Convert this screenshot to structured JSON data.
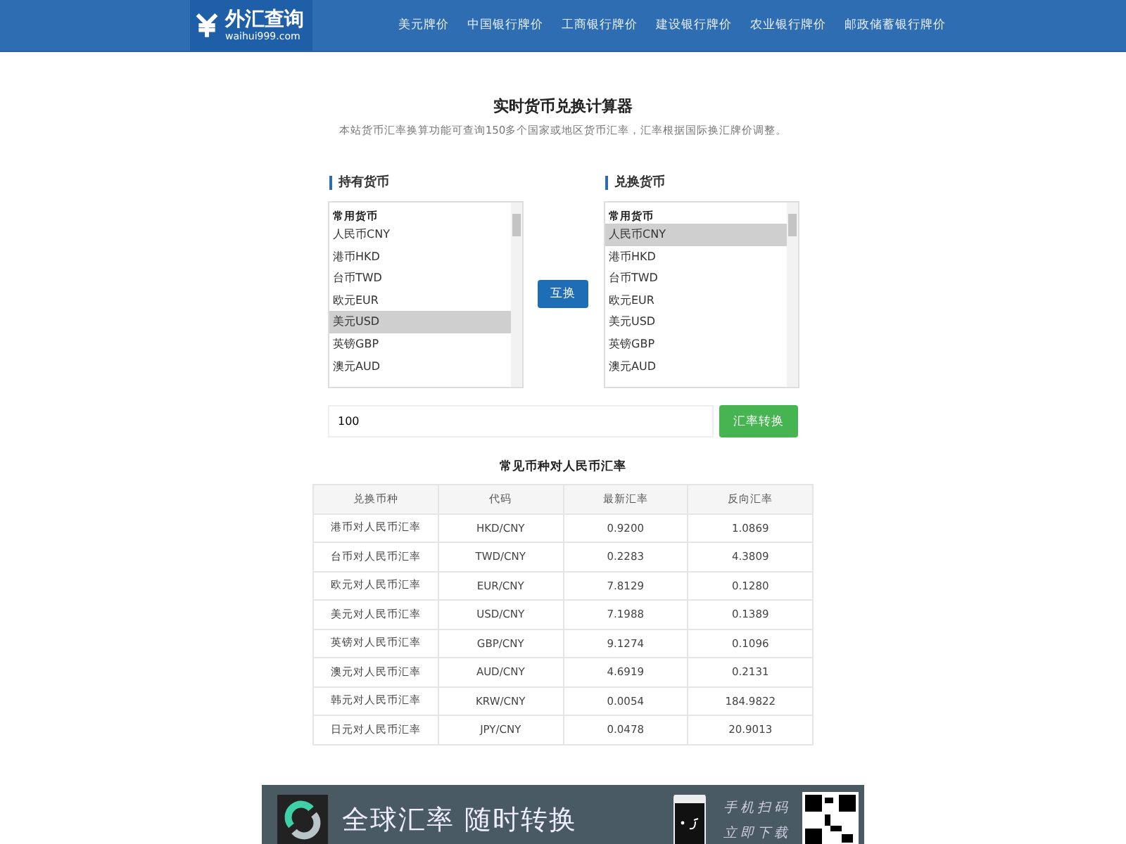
{
  "site": {
    "logo_text": "外汇查询",
    "logo_domain": "waihui999.com"
  },
  "nav": [
    "美元牌价",
    "中国银行牌价",
    "工商银行牌价",
    "建设银行牌价",
    "农业银行牌价",
    "邮政储蓄银行牌价"
  ],
  "title": "实时货币兑换计算器",
  "subtitle": "本站货币汇率换算功能可查询150多个国家或地区货币汇率，汇率根据国际换汇牌价调整。",
  "from": {
    "label": "持有货币",
    "group": "常用货币",
    "items": [
      {
        "label": "人民币CNY",
        "selected": false
      },
      {
        "label": "港币HKD",
        "selected": false
      },
      {
        "label": "台币TWD",
        "selected": false
      },
      {
        "label": "欧元EUR",
        "selected": false
      },
      {
        "label": "美元USD",
        "selected": true
      },
      {
        "label": "英镑GBP",
        "selected": false
      },
      {
        "label": "澳元AUD",
        "selected": false
      }
    ]
  },
  "swap_button": "互换",
  "to": {
    "label": "兑换货币",
    "group": "常用货币",
    "items": [
      {
        "label": "人民币CNY",
        "selected": true
      },
      {
        "label": "港币HKD",
        "selected": false
      },
      {
        "label": "台币TWD",
        "selected": false
      },
      {
        "label": "欧元EUR",
        "selected": false
      },
      {
        "label": "美元USD",
        "selected": false
      },
      {
        "label": "英镑GBP",
        "selected": false
      },
      {
        "label": "澳元AUD",
        "selected": false
      }
    ]
  },
  "amount": {
    "value": "100"
  },
  "convert_button": "汇率转换",
  "table": {
    "title": "常见币种对人民币汇率",
    "columns": [
      "兑换币种",
      "代码",
      "最新汇率",
      "反向汇率"
    ],
    "rows": [
      [
        "港币对人民币汇率",
        "HKD/CNY",
        "0.9200",
        "1.0869"
      ],
      [
        "台币对人民币汇率",
        "TWD/CNY",
        "0.2283",
        "4.3809"
      ],
      [
        "欧元对人民币汇率",
        "EUR/CNY",
        "7.8129",
        "0.1280"
      ],
      [
        "美元对人民币汇率",
        "USD/CNY",
        "7.1988",
        "0.1389"
      ],
      [
        "英镑对人民币汇率",
        "GBP/CNY",
        "9.1274",
        "0.1096"
      ],
      [
        "澳元对人民币汇率",
        "AUD/CNY",
        "4.6919",
        "0.2131"
      ],
      [
        "韩元对人民币汇率",
        "KRW/CNY",
        "0.0054",
        "184.9822"
      ],
      [
        "日元对人民币汇率",
        "JPY/CNY",
        "0.0478",
        "20.9013"
      ]
    ]
  },
  "banner": {
    "slogan": "全球汇率 随时转换",
    "scan_line1": "手机扫码",
    "scan_line2": "立即下载"
  }
}
